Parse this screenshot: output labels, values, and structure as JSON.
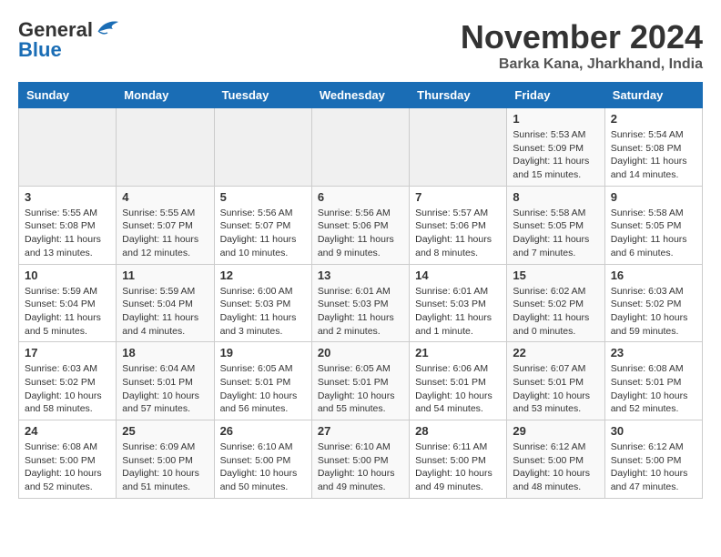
{
  "logo": {
    "general": "General",
    "blue": "Blue"
  },
  "title": "November 2024",
  "location": "Barka Kana, Jharkhand, India",
  "headers": [
    "Sunday",
    "Monday",
    "Tuesday",
    "Wednesday",
    "Thursday",
    "Friday",
    "Saturday"
  ],
  "weeks": [
    [
      {
        "day": "",
        "info": ""
      },
      {
        "day": "",
        "info": ""
      },
      {
        "day": "",
        "info": ""
      },
      {
        "day": "",
        "info": ""
      },
      {
        "day": "",
        "info": ""
      },
      {
        "day": "1",
        "info": "Sunrise: 5:53 AM\nSunset: 5:09 PM\nDaylight: 11 hours and 15 minutes."
      },
      {
        "day": "2",
        "info": "Sunrise: 5:54 AM\nSunset: 5:08 PM\nDaylight: 11 hours and 14 minutes."
      }
    ],
    [
      {
        "day": "3",
        "info": "Sunrise: 5:55 AM\nSunset: 5:08 PM\nDaylight: 11 hours and 13 minutes."
      },
      {
        "day": "4",
        "info": "Sunrise: 5:55 AM\nSunset: 5:07 PM\nDaylight: 11 hours and 12 minutes."
      },
      {
        "day": "5",
        "info": "Sunrise: 5:56 AM\nSunset: 5:07 PM\nDaylight: 11 hours and 10 minutes."
      },
      {
        "day": "6",
        "info": "Sunrise: 5:56 AM\nSunset: 5:06 PM\nDaylight: 11 hours and 9 minutes."
      },
      {
        "day": "7",
        "info": "Sunrise: 5:57 AM\nSunset: 5:06 PM\nDaylight: 11 hours and 8 minutes."
      },
      {
        "day": "8",
        "info": "Sunrise: 5:58 AM\nSunset: 5:05 PM\nDaylight: 11 hours and 7 minutes."
      },
      {
        "day": "9",
        "info": "Sunrise: 5:58 AM\nSunset: 5:05 PM\nDaylight: 11 hours and 6 minutes."
      }
    ],
    [
      {
        "day": "10",
        "info": "Sunrise: 5:59 AM\nSunset: 5:04 PM\nDaylight: 11 hours and 5 minutes."
      },
      {
        "day": "11",
        "info": "Sunrise: 5:59 AM\nSunset: 5:04 PM\nDaylight: 11 hours and 4 minutes."
      },
      {
        "day": "12",
        "info": "Sunrise: 6:00 AM\nSunset: 5:03 PM\nDaylight: 11 hours and 3 minutes."
      },
      {
        "day": "13",
        "info": "Sunrise: 6:01 AM\nSunset: 5:03 PM\nDaylight: 11 hours and 2 minutes."
      },
      {
        "day": "14",
        "info": "Sunrise: 6:01 AM\nSunset: 5:03 PM\nDaylight: 11 hours and 1 minute."
      },
      {
        "day": "15",
        "info": "Sunrise: 6:02 AM\nSunset: 5:02 PM\nDaylight: 11 hours and 0 minutes."
      },
      {
        "day": "16",
        "info": "Sunrise: 6:03 AM\nSunset: 5:02 PM\nDaylight: 10 hours and 59 minutes."
      }
    ],
    [
      {
        "day": "17",
        "info": "Sunrise: 6:03 AM\nSunset: 5:02 PM\nDaylight: 10 hours and 58 minutes."
      },
      {
        "day": "18",
        "info": "Sunrise: 6:04 AM\nSunset: 5:01 PM\nDaylight: 10 hours and 57 minutes."
      },
      {
        "day": "19",
        "info": "Sunrise: 6:05 AM\nSunset: 5:01 PM\nDaylight: 10 hours and 56 minutes."
      },
      {
        "day": "20",
        "info": "Sunrise: 6:05 AM\nSunset: 5:01 PM\nDaylight: 10 hours and 55 minutes."
      },
      {
        "day": "21",
        "info": "Sunrise: 6:06 AM\nSunset: 5:01 PM\nDaylight: 10 hours and 54 minutes."
      },
      {
        "day": "22",
        "info": "Sunrise: 6:07 AM\nSunset: 5:01 PM\nDaylight: 10 hours and 53 minutes."
      },
      {
        "day": "23",
        "info": "Sunrise: 6:08 AM\nSunset: 5:01 PM\nDaylight: 10 hours and 52 minutes."
      }
    ],
    [
      {
        "day": "24",
        "info": "Sunrise: 6:08 AM\nSunset: 5:00 PM\nDaylight: 10 hours and 52 minutes."
      },
      {
        "day": "25",
        "info": "Sunrise: 6:09 AM\nSunset: 5:00 PM\nDaylight: 10 hours and 51 minutes."
      },
      {
        "day": "26",
        "info": "Sunrise: 6:10 AM\nSunset: 5:00 PM\nDaylight: 10 hours and 50 minutes."
      },
      {
        "day": "27",
        "info": "Sunrise: 6:10 AM\nSunset: 5:00 PM\nDaylight: 10 hours and 49 minutes."
      },
      {
        "day": "28",
        "info": "Sunrise: 6:11 AM\nSunset: 5:00 PM\nDaylight: 10 hours and 49 minutes."
      },
      {
        "day": "29",
        "info": "Sunrise: 6:12 AM\nSunset: 5:00 PM\nDaylight: 10 hours and 48 minutes."
      },
      {
        "day": "30",
        "info": "Sunrise: 6:12 AM\nSunset: 5:00 PM\nDaylight: 10 hours and 47 minutes."
      }
    ]
  ]
}
